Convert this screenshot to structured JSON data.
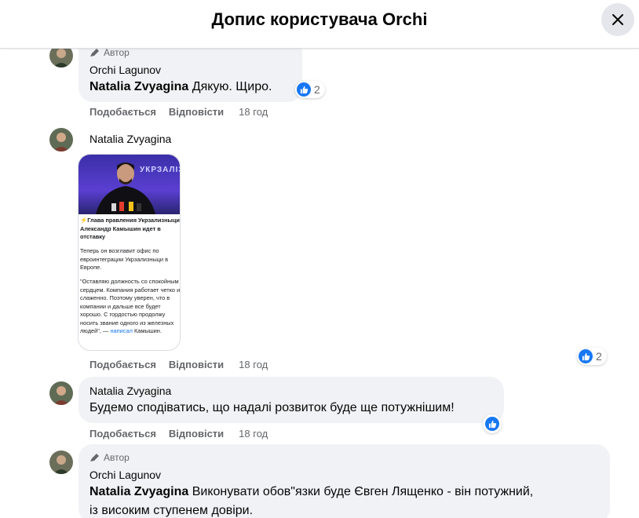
{
  "header": {
    "title": "Допис користувача Orchi"
  },
  "comments": [
    {
      "author_badge": "Автор",
      "name": "Orchi Lagunov",
      "mention": "Natalia Zvyagina",
      "text": " Дякую. Щиро.",
      "reactions": "2",
      "like": "Подобається",
      "reply": "Відповісти",
      "time": "18 год"
    },
    {
      "name": "Natalia Zvyagina",
      "image": {
        "headline": "⚡Глава правления Укрзализныци Александр Камышин идет в отставку",
        "para1": "Теперь он возглавит офис по евроинтеграции Укрзализныци в Европе.",
        "para2": "\"Оставляю должность со спокойным сердцем. Компания работает четко и слаженно. Поэтому уверен, что в компании и дальше все будет хорошо. С гордостью продолжу носить звание одного из железных людей\", —",
        "para2_link": "написал",
        "para2_end": " Камышин.",
        "banner": "УКРЗАЛІЗНИЦ"
      },
      "reactions": "2",
      "like": "Подобається",
      "reply": "Відповісти",
      "time": "18 год"
    },
    {
      "name": "Natalia Zvyagina",
      "text": "Будемо сподіватись, що надалі розвиток буде ще потужнішим!",
      "like": "Подобається",
      "reply": "Відповісти",
      "time": "18 год"
    },
    {
      "author_badge": "Автор",
      "name": "Orchi Lagunov",
      "mention": "Natalia Zvyagina",
      "text_line1": " Виконувати обов\"язки буде Євген Лященко - він потужний,",
      "text_line2": "із високим ступенем довіри."
    }
  ],
  "colors": {
    "accent": "#1877f2",
    "bubble": "#f0f2f5",
    "muted": "#65676b"
  },
  "icons": {
    "close": "close-icon",
    "author": "pencil-icon",
    "like": "thumbs-up-icon"
  }
}
